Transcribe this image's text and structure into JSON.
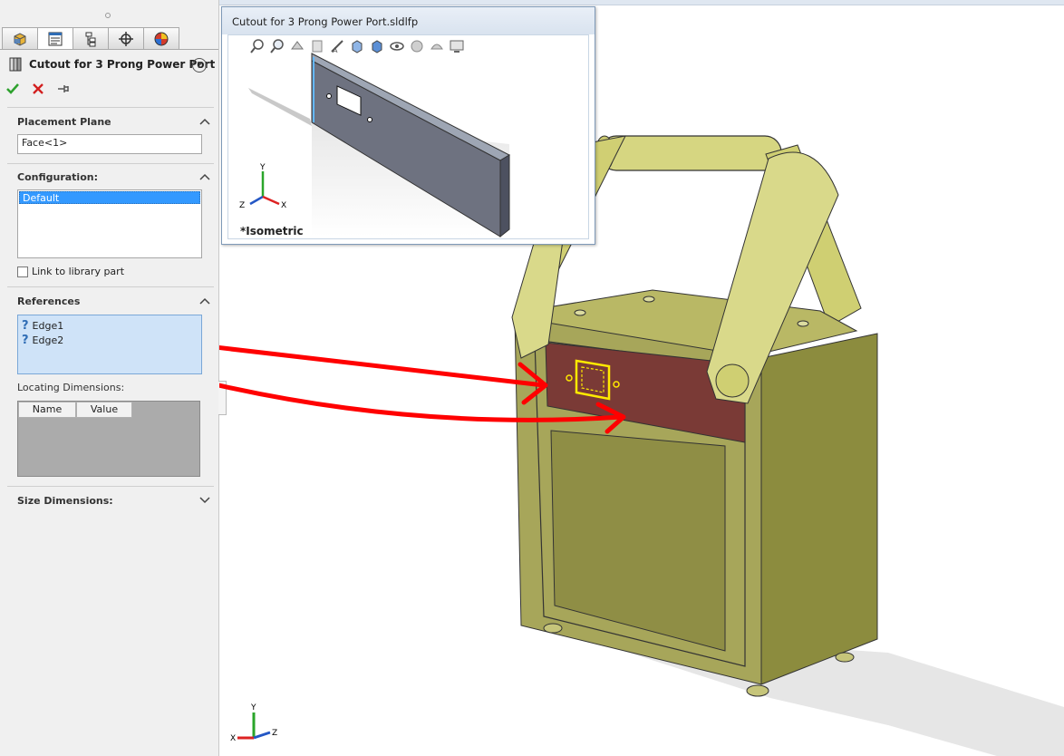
{
  "panel": {
    "title": "Cutout for 3 Prong Power Port",
    "help_icon": "?",
    "placement_plane": {
      "label": "Placement Plane",
      "value": "Face<1>"
    },
    "configuration": {
      "label": "Configuration:",
      "selected": "Default"
    },
    "link_to_library": {
      "label": "Link to library part",
      "underline_char": "L"
    },
    "references": {
      "label": "References",
      "items": [
        "Edge1",
        "Edge2"
      ]
    },
    "locating_dimensions": {
      "label": "Locating Dimensions:",
      "columns": [
        "Name",
        "Value"
      ]
    },
    "size_dimensions": {
      "label": "Size Dimensions:"
    }
  },
  "preview": {
    "title": "Cutout for 3 Prong Power Port.sldlfp",
    "view_label": "*Isometric"
  },
  "axes": {
    "x": "X",
    "y": "Y",
    "z": "Z"
  },
  "colors": {
    "box_face": "#a7a65a",
    "box_side": "#8c8c3e",
    "handle": "#d9d98a",
    "highlight_face": "#7a3a36",
    "arrow": "#ff0000",
    "selection_blue": "#3399ff"
  }
}
